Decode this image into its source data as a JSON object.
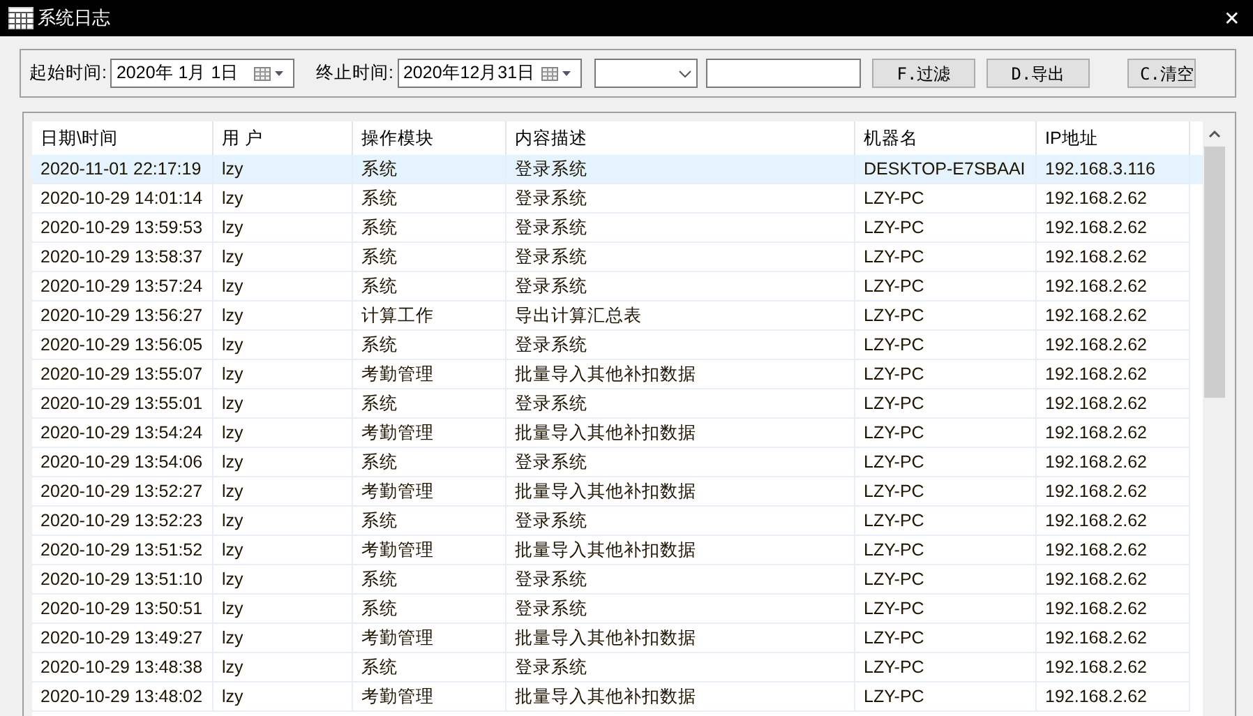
{
  "window": {
    "title": "系统日志",
    "close": "✕"
  },
  "filter": {
    "start_label": "起始时间:",
    "start_date": "2020年  1月  1日",
    "end_label": "终止时间:",
    "end_date": "2020年12月31日",
    "buttons": [
      "F.过滤",
      "D.导出",
      "C.清空"
    ]
  },
  "table": {
    "columns": [
      "日期\\时间",
      "用  户",
      "操作模块",
      "内容描述",
      "机器名",
      "IP地址"
    ],
    "rows": [
      {
        "selected": true,
        "cells": [
          "2020-11-01 22:17:19",
          "lzy",
          "系统",
          "登录系统",
          "DESKTOP-E7SBAAI",
          "192.168.3.116"
        ]
      },
      {
        "selected": false,
        "cells": [
          "2020-10-29 14:01:14",
          "lzy",
          "系统",
          "登录系统",
          "LZY-PC",
          "192.168.2.62"
        ]
      },
      {
        "selected": false,
        "cells": [
          "2020-10-29 13:59:53",
          "lzy",
          "系统",
          "登录系统",
          "LZY-PC",
          "192.168.2.62"
        ]
      },
      {
        "selected": false,
        "cells": [
          "2020-10-29 13:58:37",
          "lzy",
          "系统",
          "登录系统",
          "LZY-PC",
          "192.168.2.62"
        ]
      },
      {
        "selected": false,
        "cells": [
          "2020-10-29 13:57:24",
          "lzy",
          "系统",
          "登录系统",
          "LZY-PC",
          "192.168.2.62"
        ]
      },
      {
        "selected": false,
        "cells": [
          "2020-10-29 13:56:27",
          "lzy",
          "计算工作",
          "导出计算汇总表",
          "LZY-PC",
          "192.168.2.62"
        ]
      },
      {
        "selected": false,
        "cells": [
          "2020-10-29 13:56:05",
          "lzy",
          "系统",
          "登录系统",
          "LZY-PC",
          "192.168.2.62"
        ]
      },
      {
        "selected": false,
        "cells": [
          "2020-10-29 13:55:07",
          "lzy",
          "考勤管理",
          "批量导入其他补扣数据",
          "LZY-PC",
          "192.168.2.62"
        ]
      },
      {
        "selected": false,
        "cells": [
          "2020-10-29 13:55:01",
          "lzy",
          "系统",
          "登录系统",
          "LZY-PC",
          "192.168.2.62"
        ]
      },
      {
        "selected": false,
        "cells": [
          "2020-10-29 13:54:24",
          "lzy",
          "考勤管理",
          "批量导入其他补扣数据",
          "LZY-PC",
          "192.168.2.62"
        ]
      },
      {
        "selected": false,
        "cells": [
          "2020-10-29 13:54:06",
          "lzy",
          "系统",
          "登录系统",
          "LZY-PC",
          "192.168.2.62"
        ]
      },
      {
        "selected": false,
        "cells": [
          "2020-10-29 13:52:27",
          "lzy",
          "考勤管理",
          "批量导入其他补扣数据",
          "LZY-PC",
          "192.168.2.62"
        ]
      },
      {
        "selected": false,
        "cells": [
          "2020-10-29 13:52:23",
          "lzy",
          "系统",
          "登录系统",
          "LZY-PC",
          "192.168.2.62"
        ]
      },
      {
        "selected": false,
        "cells": [
          "2020-10-29 13:51:52",
          "lzy",
          "考勤管理",
          "批量导入其他补扣数据",
          "LZY-PC",
          "192.168.2.62"
        ]
      },
      {
        "selected": false,
        "cells": [
          "2020-10-29 13:51:10",
          "lzy",
          "系统",
          "登录系统",
          "LZY-PC",
          "192.168.2.62"
        ]
      },
      {
        "selected": false,
        "cells": [
          "2020-10-29 13:50:51",
          "lzy",
          "系统",
          "登录系统",
          "LZY-PC",
          "192.168.2.62"
        ]
      },
      {
        "selected": false,
        "cells": [
          "2020-10-29 13:49:27",
          "lzy",
          "考勤管理",
          "批量导入其他补扣数据",
          "LZY-PC",
          "192.168.2.62"
        ]
      },
      {
        "selected": false,
        "cells": [
          "2020-10-29 13:48:38",
          "lzy",
          "系统",
          "登录系统",
          "LZY-PC",
          "192.168.2.62"
        ]
      },
      {
        "selected": false,
        "cells": [
          "2020-10-29 13:48:02",
          "lzy",
          "考勤管理",
          "批量导入其他补扣数据",
          "LZY-PC",
          "192.168.2.62"
        ]
      }
    ]
  }
}
